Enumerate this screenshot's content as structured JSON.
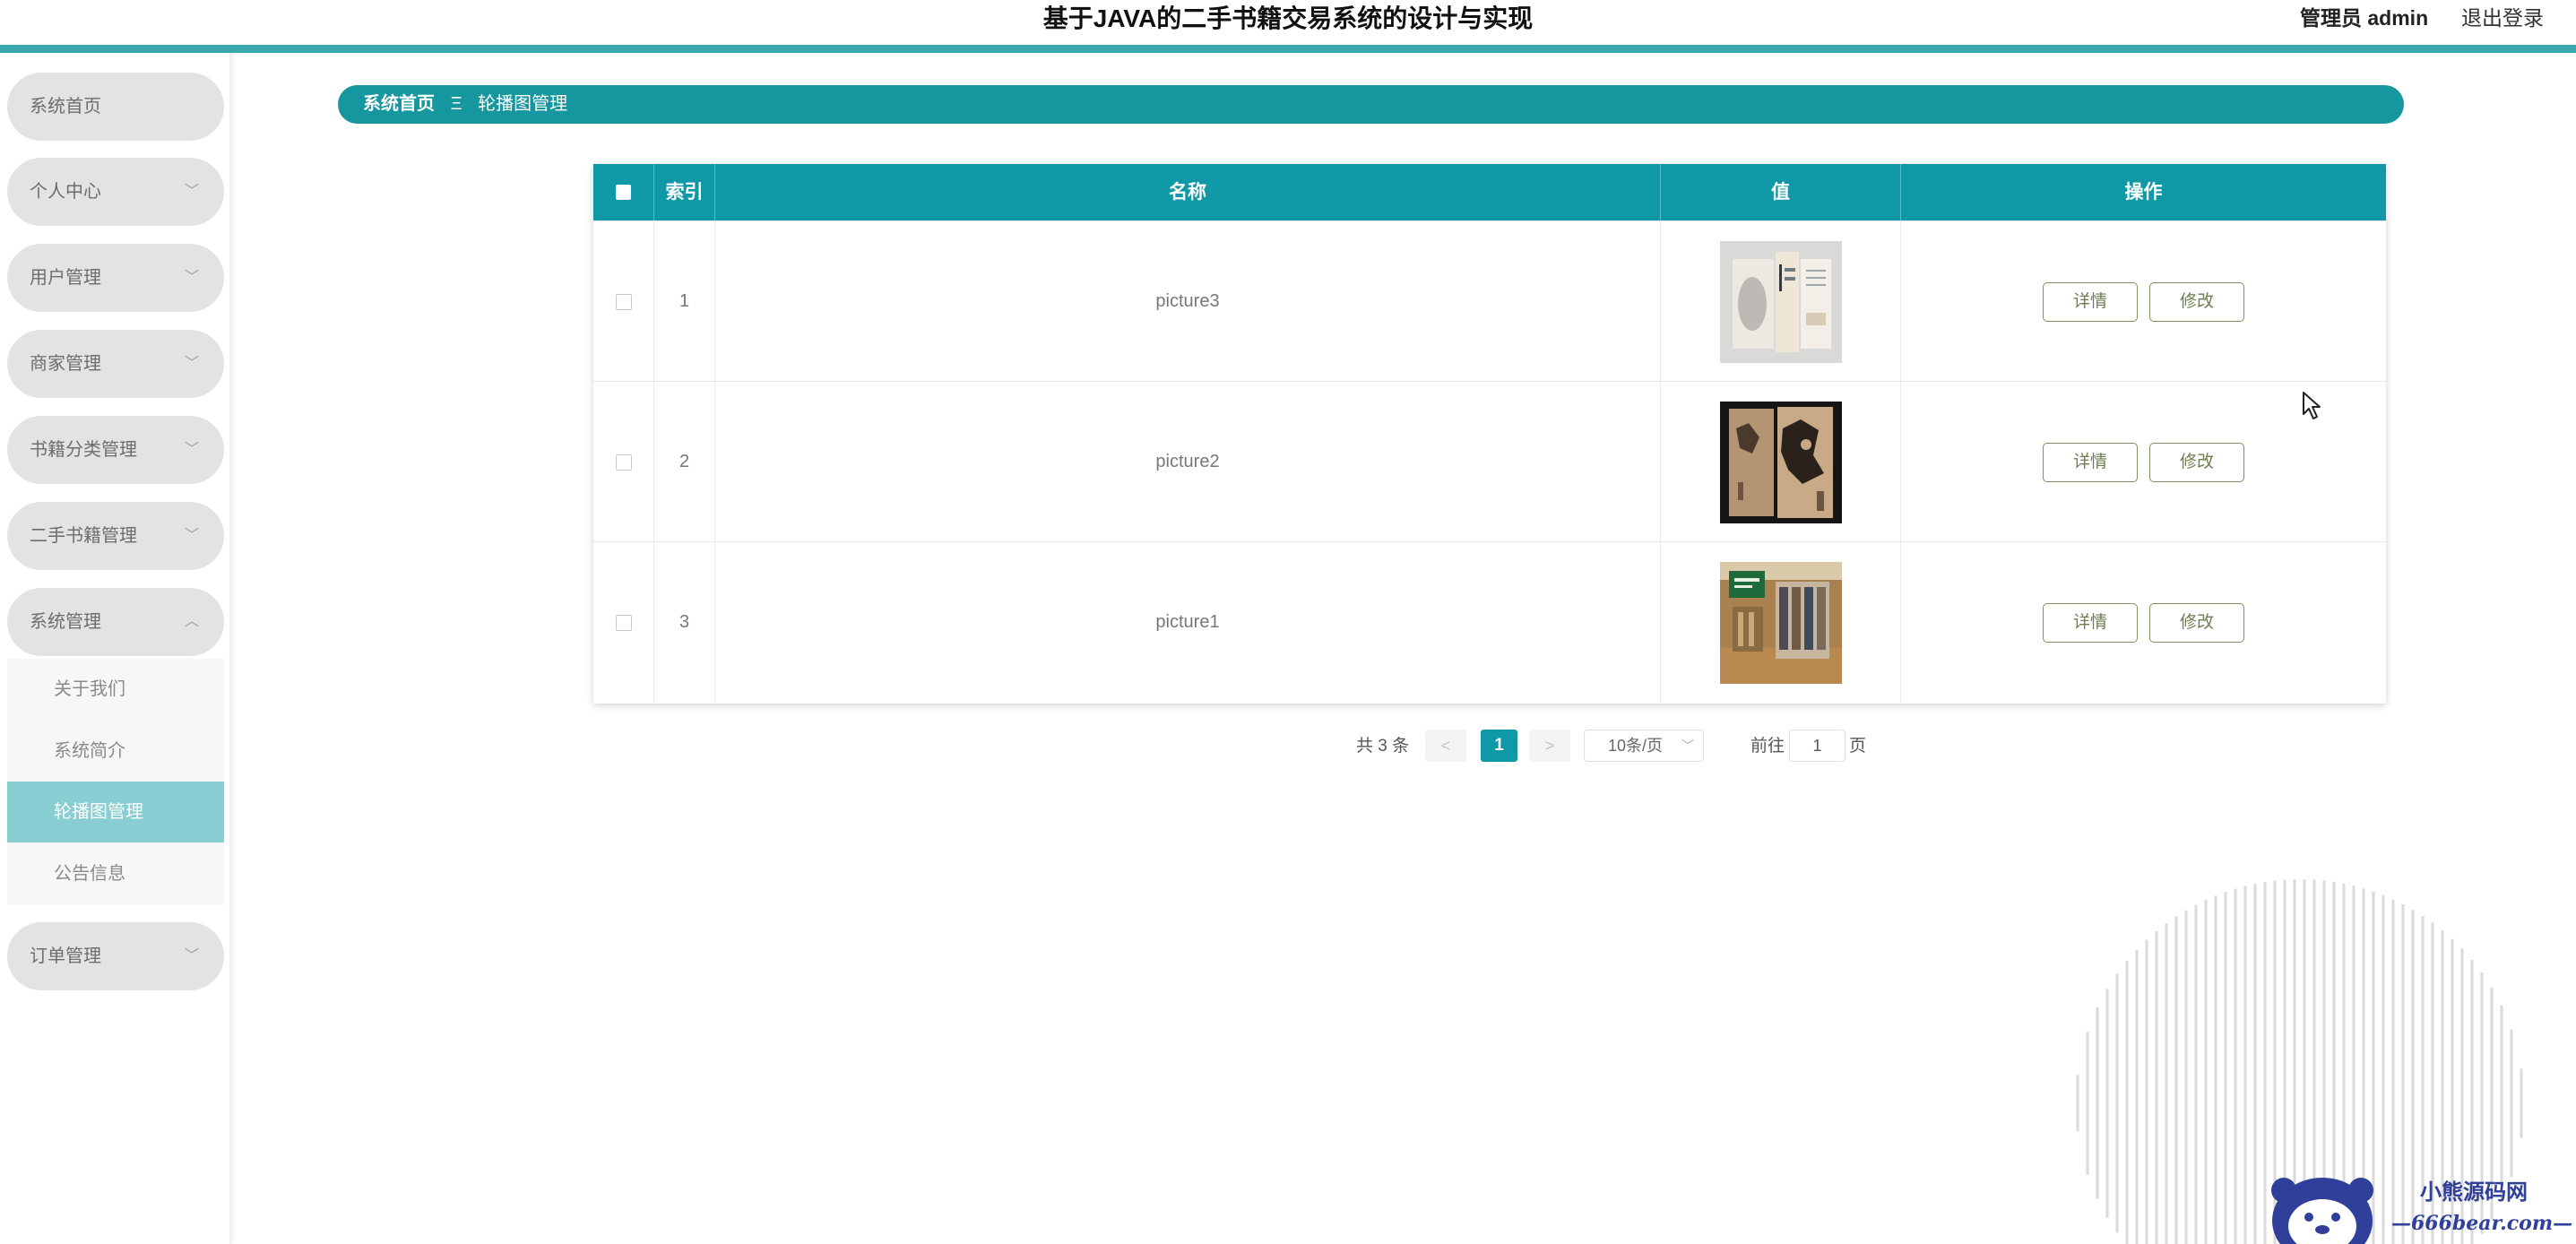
{
  "header": {
    "title": "基于JAVA的二手书籍交易系统的设计与实现",
    "admin_label": "管理员 admin",
    "logout_label": "退出登录"
  },
  "sidebar": {
    "items": [
      {
        "label": "系统首页",
        "expandable": false
      },
      {
        "label": "个人中心",
        "expandable": true
      },
      {
        "label": "用户管理",
        "expandable": true
      },
      {
        "label": "商家管理",
        "expandable": true
      },
      {
        "label": "书籍分类管理",
        "expandable": true
      },
      {
        "label": "二手书籍管理",
        "expandable": true
      },
      {
        "label": "系统管理",
        "expandable": true,
        "expanded": true
      },
      {
        "label": "订单管理",
        "expandable": true
      }
    ],
    "submenu": [
      {
        "label": "关于我们"
      },
      {
        "label": "系统简介"
      },
      {
        "label": "轮播图管理",
        "active": true
      },
      {
        "label": "公告信息"
      }
    ]
  },
  "breadcrumb": {
    "home": "系统首页",
    "separator": "Ξ",
    "current": "轮播图管理"
  },
  "table": {
    "headers": {
      "index": "索引",
      "name": "名称",
      "value": "值",
      "actions": "操作"
    },
    "rows": [
      {
        "index": "1",
        "name": "picture3",
        "image": "bookshelf-brochure-image"
      },
      {
        "index": "2",
        "name": "picture2",
        "image": "dark-book-covers-image"
      },
      {
        "index": "3",
        "name": "picture1",
        "image": "bookstore-interior-image"
      }
    ],
    "detail_label": "详情",
    "edit_label": "修改"
  },
  "pagination": {
    "total_text": "共 3 条",
    "prev": "<",
    "current_page": "1",
    "next": ">",
    "page_size": "10条/页",
    "goto_prefix": "前往",
    "goto_value": "1",
    "goto_suffix": "页"
  },
  "watermark": {
    "line1": "小熊源码网",
    "line2": "—666bear.com—"
  },
  "colors": {
    "accent": "#0f99a6",
    "header_line": "#3aa6ad",
    "active_sub": "#88cdd1",
    "menu_bg": "#e3e3e3"
  }
}
